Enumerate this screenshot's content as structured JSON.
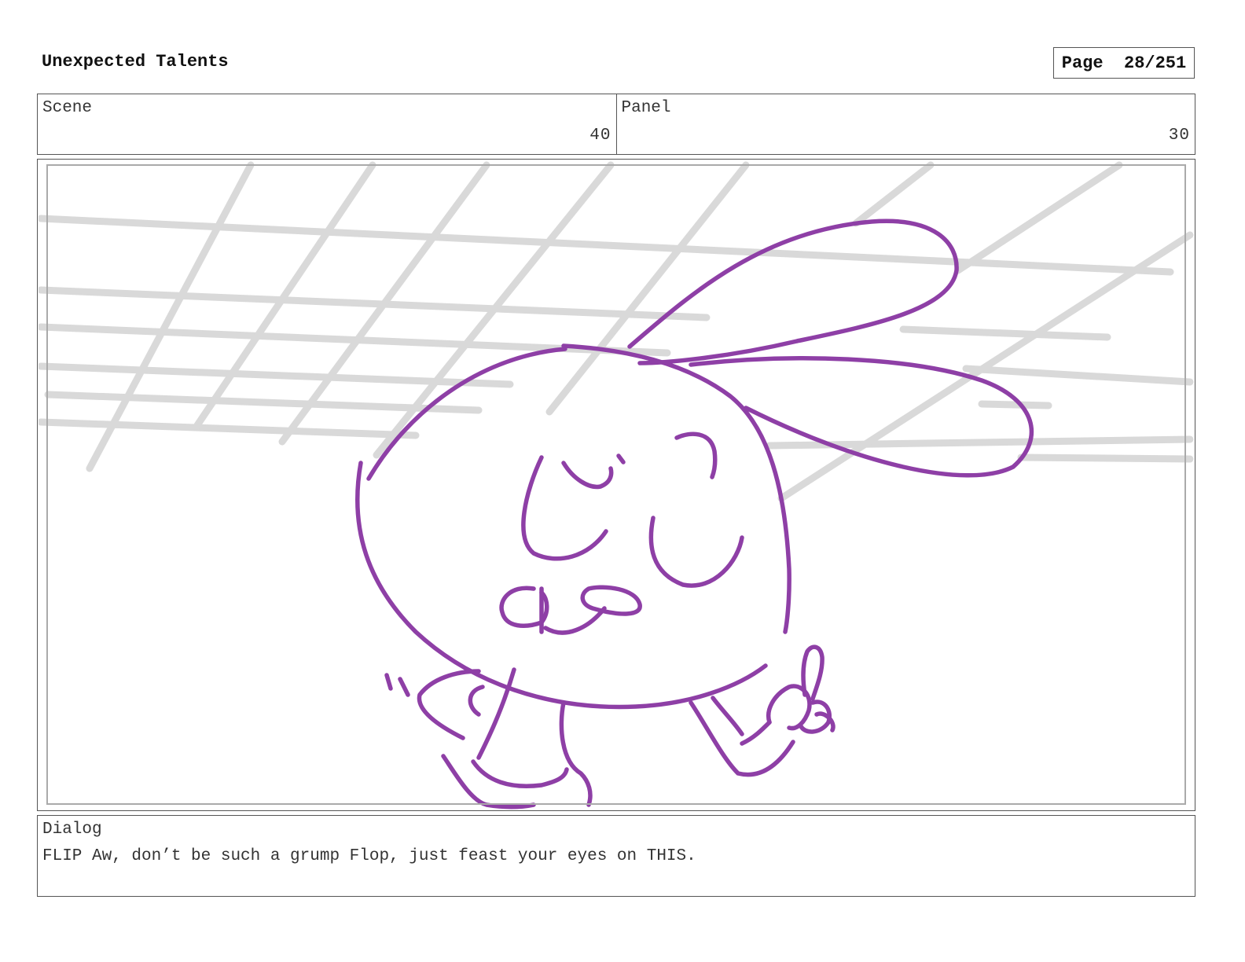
{
  "header": {
    "title": "Unexpected Talents",
    "page_label": "Page",
    "page_value": "28/251"
  },
  "info": {
    "scene_label": "Scene",
    "scene_value": "40",
    "panel_label": "Panel",
    "panel_value": "30"
  },
  "sketch": {
    "description_icon": "rabbit-character-sketch",
    "line_color": "#8e3fa6",
    "grid_color": "#d6d6d6"
  },
  "dialog": {
    "label": "Dialog",
    "text": "FLIP Aw, don’t be such a grump Flop, just feast your eyes on THIS."
  }
}
